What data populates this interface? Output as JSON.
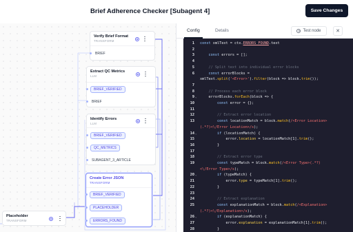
{
  "header": {
    "title": "Brief Adherence Checker [Subagent 4]",
    "save_label": "Save Changes"
  },
  "canvas": {
    "nodes": [
      {
        "id": "verify",
        "title": "Verify Brief Format",
        "type": "TRANSFORM",
        "ports": [
          {
            "label": "BRIEF",
            "chip": false
          }
        ]
      },
      {
        "id": "extract",
        "title": "Extract QC Metrics",
        "type": "LLM",
        "ports": [
          {
            "label": "BRIEF_VERIFIED",
            "chip": true
          },
          {
            "label": "BRIEF",
            "chip": false
          }
        ]
      },
      {
        "id": "identify",
        "title": "Identify Errors",
        "type": "LLM",
        "ports": [
          {
            "label": "BRIEF_VERIFIED",
            "chip": true
          },
          {
            "label": "QC_METRICS",
            "chip": true
          },
          {
            "label": "SUBAGENT_3_ARTICLE",
            "chip": false
          }
        ]
      },
      {
        "id": "create",
        "title": "Create Error JSON",
        "type": "TRANSFORM",
        "ports": [
          {
            "label": "BRIEF_VERIFIED",
            "chip": true
          },
          {
            "label": "PLACEHOLDER",
            "chip": true
          },
          {
            "label": "ERRORS_FOUND",
            "chip": true
          }
        ]
      },
      {
        "id": "placeholder",
        "title": "Placeholder",
        "type": "TRANSFORM",
        "ports": []
      }
    ]
  },
  "panel": {
    "tabs": [
      "Config",
      "Details"
    ],
    "test_label": "Test node",
    "close_glyph": "✕"
  },
  "code_lines": [
    {
      "n": "1",
      "t": [
        [
          "kw",
          "const "
        ],
        [
          "",
          "xmlText = ctx."
        ],
        [
          "hl",
          "ERRORS_FOUND"
        ],
        [
          "",
          ".text"
        ]
      ]
    },
    {
      "n": "2",
      "t": []
    },
    {
      "n": "3",
      "t": [
        [
          "",
          "    "
        ],
        [
          "kw",
          "const "
        ],
        [
          "",
          "errors = [];"
        ]
      ]
    },
    {
      "n": "4",
      "t": []
    },
    {
      "n": "5",
      "t": [
        [
          "cm",
          "    // Split text into individual error blocks"
        ]
      ]
    },
    {
      "n": "6",
      "t": [
        [
          "",
          "    "
        ],
        [
          "kw",
          "const "
        ],
        [
          "",
          "errorBlocks ="
        ]
      ]
    },
    {
      "n": "",
      "t": [
        [
          "",
          "xmlText."
        ],
        [
          "fn",
          "split"
        ],
        [
          "",
          "("
        ],
        [
          "str",
          "'<Error>'"
        ],
        [
          "",
          ")."
        ],
        [
          "fn",
          "filter"
        ],
        [
          "",
          "(block => block."
        ],
        [
          "fn",
          "trim"
        ],
        [
          "",
          "());"
        ]
      ]
    },
    {
      "n": "7",
      "t": []
    },
    {
      "n": "8",
      "t": [
        [
          "cm",
          "    // Process each error block"
        ]
      ]
    },
    {
      "n": "9",
      "f": true,
      "t": [
        [
          "",
          "    errorBlocks."
        ],
        [
          "fn",
          "forEach"
        ],
        [
          "",
          "(block => {"
        ]
      ]
    },
    {
      "n": "10",
      "t": [
        [
          "",
          "        "
        ],
        [
          "kw",
          "const "
        ],
        [
          "",
          "error = {};"
        ]
      ]
    },
    {
      "n": "11",
      "t": []
    },
    {
      "n": "12",
      "t": [
        [
          "cm",
          "        // Extract error location"
        ]
      ]
    },
    {
      "n": "13",
      "t": [
        [
          "",
          "        "
        ],
        [
          "kw",
          "const "
        ],
        [
          "",
          "locationMatch = block."
        ],
        [
          "fn",
          "match"
        ],
        [
          "",
          "("
        ],
        [
          "str",
          "/<Error Location>"
        ]
      ]
    },
    {
      "n": "",
      "t": [
        [
          "str",
          "(.*?)<\\/Error Location>/s"
        ],
        [
          "",
          ");"
        ]
      ]
    },
    {
      "n": "14",
      "f": true,
      "t": [
        [
          "",
          "        "
        ],
        [
          "kw",
          "if "
        ],
        [
          "",
          "(locationMatch) {"
        ]
      ]
    },
    {
      "n": "15",
      "t": [
        [
          "",
          "            error."
        ],
        [
          "prop",
          "location"
        ],
        [
          "",
          " = locationMatch[1]."
        ],
        [
          "fn",
          "trim"
        ],
        [
          "",
          "();"
        ]
      ]
    },
    {
      "n": "16",
      "t": [
        [
          "",
          "        }"
        ]
      ]
    },
    {
      "n": "17",
      "t": []
    },
    {
      "n": "18",
      "t": [
        [
          "cm",
          "        // Extract error type"
        ]
      ]
    },
    {
      "n": "19",
      "t": [
        [
          "",
          "        "
        ],
        [
          "kw",
          "const "
        ],
        [
          "",
          "typeMatch = block."
        ],
        [
          "fn",
          "match"
        ],
        [
          "",
          "("
        ],
        [
          "str",
          "/<Error Type>(.*?)"
        ]
      ]
    },
    {
      "n": "",
      "t": [
        [
          "str",
          "<\\/Error Type>/s"
        ],
        [
          "",
          ");"
        ]
      ]
    },
    {
      "n": "20",
      "f": true,
      "t": [
        [
          "",
          "        "
        ],
        [
          "kw",
          "if "
        ],
        [
          "",
          "(typeMatch) {"
        ]
      ]
    },
    {
      "n": "21",
      "t": [
        [
          "",
          "            error."
        ],
        [
          "prop",
          "type"
        ],
        [
          "",
          " = typeMatch[1]."
        ],
        [
          "fn",
          "trim"
        ],
        [
          "",
          "();"
        ]
      ]
    },
    {
      "n": "22",
      "t": [
        [
          "",
          "        }"
        ]
      ]
    },
    {
      "n": "23",
      "t": []
    },
    {
      "n": "24",
      "t": [
        [
          "cm",
          "        // Extract explanation"
        ]
      ]
    },
    {
      "n": "25",
      "t": [
        [
          "",
          "        "
        ],
        [
          "kw",
          "const "
        ],
        [
          "",
          "explanationMatch = block."
        ],
        [
          "fn",
          "match"
        ],
        [
          "",
          "("
        ],
        [
          "str",
          "/<Explanation>"
        ]
      ]
    },
    {
      "n": "",
      "t": [
        [
          "str",
          "(.*?)<\\/Explanation>/s"
        ],
        [
          "",
          ");"
        ]
      ]
    },
    {
      "n": "26",
      "f": true,
      "t": [
        [
          "",
          "        "
        ],
        [
          "kw",
          "if "
        ],
        [
          "",
          "(explanationMatch) {"
        ]
      ]
    },
    {
      "n": "27",
      "t": [
        [
          "",
          "            error."
        ],
        [
          "prop",
          "explanation"
        ],
        [
          "",
          " = explanationMatch[1]."
        ],
        [
          "fn",
          "trim"
        ],
        [
          "",
          "();"
        ]
      ]
    },
    {
      "n": "28",
      "t": [
        [
          "",
          "        }"
        ]
      ]
    }
  ],
  "colors": {
    "accent": "#6366f1",
    "save_bg": "#0f172a",
    "editor_bg": "#1e1e2e"
  }
}
